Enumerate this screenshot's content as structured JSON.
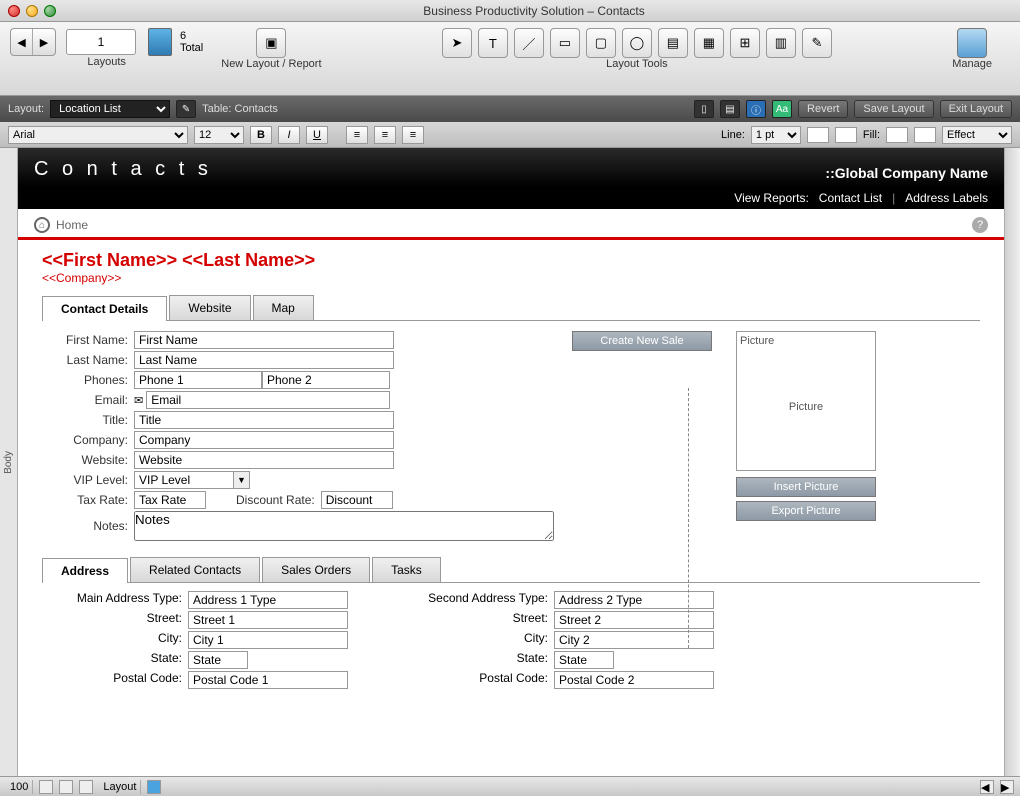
{
  "window": {
    "title": "Business Productivity Solution – Contacts"
  },
  "toolbar": {
    "record_current": "1",
    "total_count": "6",
    "total_label": "Total",
    "layouts_label": "Layouts",
    "new_layout_label": "New Layout / Report",
    "layout_tools_label": "Layout Tools",
    "manage_label": "Manage"
  },
  "layoutbar": {
    "layout_label": "Layout:",
    "layout_value": "Location List",
    "table_label": "Table: Contacts",
    "revert": "Revert",
    "save": "Save Layout",
    "exit": "Exit Layout",
    "aa": "Aa"
  },
  "formatbar": {
    "font": "Arial",
    "size": "12",
    "line_label": "Line:",
    "line_pt": "1 pt",
    "fill_label": "Fill:",
    "effect_label": "Effect"
  },
  "header": {
    "title": "C o n t a c t s",
    "global_company": "::Global Company Name",
    "view_reports": "View Reports:",
    "contact_list": "Contact List",
    "address_labels": "Address Labels",
    "home": "Home"
  },
  "merge": {
    "name": "<<First Name>> <<Last Name>>",
    "company": "<<Company>>"
  },
  "tabs": {
    "contact_details": "Contact Details",
    "website": "Website",
    "map": "Map"
  },
  "form": {
    "first_name_lbl": "First Name:",
    "first_name": "First Name",
    "last_name_lbl": "Last Name:",
    "last_name": "Last Name",
    "phones_lbl": "Phones:",
    "phone1": "Phone 1",
    "phone2": "Phone 2",
    "email_lbl": "Email:",
    "email": "Email",
    "title_lbl": "Title:",
    "title": "Title",
    "company_lbl": "Company:",
    "company": "Company",
    "website_lbl": "Website:",
    "website": "Website",
    "vip_lbl": "VIP Level:",
    "vip": "VIP Level",
    "tax_lbl": "Tax Rate:",
    "tax": "Tax Rate",
    "discount_lbl": "Discount Rate:",
    "discount": "Discount",
    "notes_lbl": "Notes:",
    "notes": "Notes"
  },
  "right": {
    "create_sale": "Create New Sale",
    "picture_lbl": "Picture",
    "picture_center": "Picture",
    "insert_picture": "Insert Picture",
    "export_picture": "Export Picture"
  },
  "subtabs": {
    "address": "Address",
    "related": "Related Contacts",
    "sales": "Sales Orders",
    "tasks": "Tasks"
  },
  "address": {
    "main_type_lbl": "Main Address Type:",
    "main_type": "Address 1 Type",
    "street1_lbl": "Street:",
    "street1": "Street 1",
    "city1_lbl": "City:",
    "city1": "City 1",
    "state1_lbl": "State:",
    "state1": "State",
    "postal1_lbl": "Postal Code:",
    "postal1": "Postal Code 1",
    "second_type_lbl": "Second Address Type:",
    "second_type": "Address 2 Type",
    "street2_lbl": "Street:",
    "street2": "Street 2",
    "city2_lbl": "City:",
    "city2": "City 2",
    "state2_lbl": "State:",
    "state2": "State",
    "postal2_lbl": "Postal Code:",
    "postal2": "Postal Code 2"
  },
  "statusbar": {
    "zoom": "100",
    "mode": "Layout"
  },
  "rail": {
    "label": "Body"
  }
}
